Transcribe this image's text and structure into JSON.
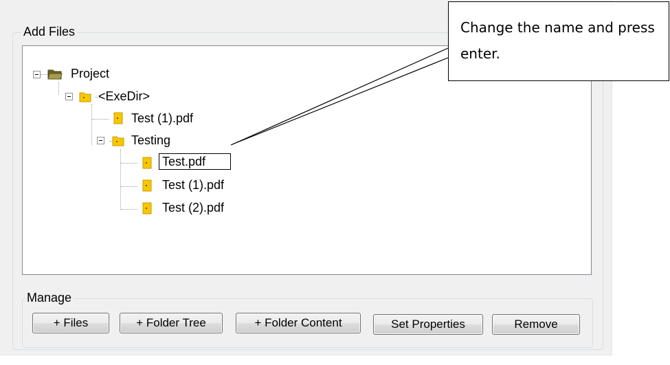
{
  "add_files": {
    "title": "Add Files",
    "tree": {
      "root": "Project",
      "exedir": "<ExeDir>",
      "exedir_file": "Test (1).pdf",
      "testing": "Testing",
      "editing_value": "Test.pdf",
      "testing_files": [
        "Test (1).pdf",
        "Test (2).pdf"
      ]
    }
  },
  "manage": {
    "title": "Manage",
    "buttons": {
      "files": "+ Files",
      "folder_tree": "+ Folder Tree",
      "folder_content": "+ Folder Content",
      "set_properties": "Set Properties",
      "remove": "Remove"
    }
  },
  "callout": {
    "text": "Change the name and press enter."
  },
  "icons": {
    "project": "folder-open-icon",
    "folder": "folder-yellow-icon",
    "file": "pdf-file-icon"
  },
  "colors": {
    "panel": "#f0f0f0",
    "folder_yellow": "#f7c700",
    "project_folder": "#8a7d3a"
  }
}
